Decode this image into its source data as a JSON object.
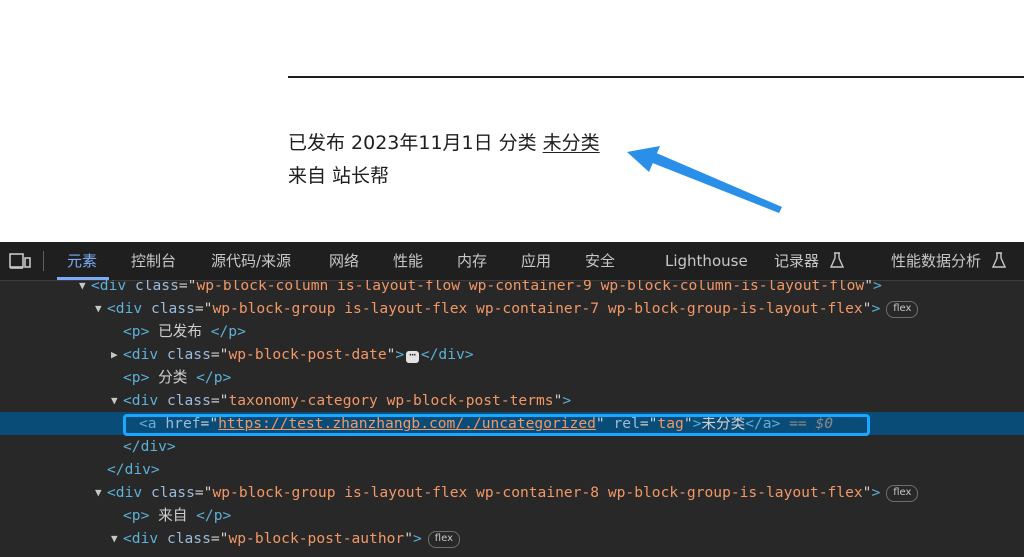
{
  "webpage": {
    "meta_line1": {
      "published_label": "已发布",
      "date": "2023年11月1日",
      "category_label": "分类",
      "category_link": "未分类"
    },
    "meta_line2": {
      "author_label": "来自",
      "author": "站长帮"
    }
  },
  "devtools": {
    "tabs": [
      {
        "label": "元素",
        "active": true
      },
      {
        "label": "控制台"
      },
      {
        "label": "源代码/来源"
      },
      {
        "label": "网络"
      },
      {
        "label": "性能"
      },
      {
        "label": "内存"
      },
      {
        "label": "应用"
      },
      {
        "label": "安全"
      },
      {
        "label": "Lighthouse"
      },
      {
        "label": "记录器"
      },
      {
        "label": "性能数据分析"
      }
    ],
    "colors": {
      "panel_bg": "#282828",
      "tag": "#5db0d7",
      "attr_name": "#9bbbdc",
      "attr_value": "#f29766",
      "selected_row": "#0a4c78",
      "selection_box": "#1aa7ff",
      "active_tab": "#7cacf8"
    },
    "dom": {
      "row0": {
        "tag_open": "<div",
        "attr": "class",
        "value": "wp-block-column is-layout-flow wp-container-9 wp-block-column-is-layout-flow",
        "close": ">"
      },
      "row1": {
        "tag_open": "<div",
        "attr": "class",
        "value": "wp-block-group is-layout-flex wp-container-7 wp-block-group-is-layout-flex",
        "close": ">",
        "badge": "flex"
      },
      "row2": {
        "open": "<p>",
        "text": " 已发布 ",
        "close": "</p>"
      },
      "row3": {
        "tag_open": "<div",
        "attr": "class",
        "value": "wp-block-post-date",
        "close": ">",
        "ellipsis": "⋯",
        "end": "</div>"
      },
      "row4": {
        "open": "<p>",
        "text": " 分类 ",
        "close": "</p>"
      },
      "row5": {
        "tag_open": "<div",
        "attr": "class",
        "value": "taxonomy-category wp-block-post-terms",
        "close": ">"
      },
      "row6": {
        "tag_open": "<a",
        "attr1": "href",
        "value1": "https://test.zhanzhangb.com/./uncategorized",
        "attr2": "rel",
        "value2": "tag",
        "close": ">",
        "text": "未分类",
        "end": "</a>",
        "eq": " == ",
        "dollar": "$0"
      },
      "row7": {
        "end": "</div>"
      },
      "row8": {
        "end": "</div>"
      },
      "row9": {
        "tag_open": "<div",
        "attr": "class",
        "value": "wp-block-group is-layout-flex wp-container-8 wp-block-group-is-layout-flex",
        "close": ">",
        "badge": "flex"
      },
      "row10": {
        "open": "<p>",
        "text": " 来自 ",
        "close": "</p>"
      },
      "row11": {
        "tag_open": "<div",
        "attr": "class",
        "value": "wp-block-post-author",
        "close": ">",
        "badge": "flex"
      }
    }
  }
}
